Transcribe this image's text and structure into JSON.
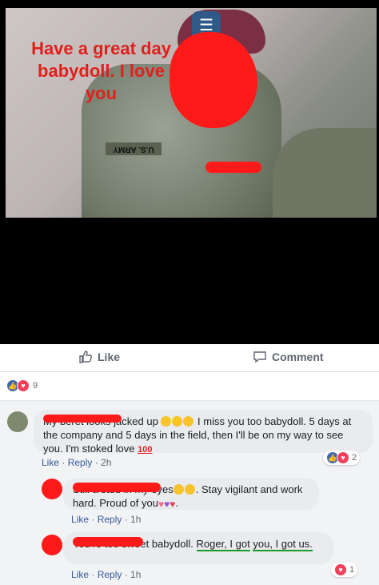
{
  "post": {
    "caption": "Have a great day babydoll. I love you",
    "nametape": "U.S. ARMY"
  },
  "actions": {
    "like_label": "Like",
    "comment_label": "Comment"
  },
  "reactions": {
    "count": "9"
  },
  "comments": [
    {
      "text_before": "My beret looks jacked up",
      "text_after": "I miss you too babydoll. 5 days at the company and 5 days in the field, then I'll be on my way to see you. I'm stoked love",
      "like": "Like",
      "reply": "Reply",
      "time": "2h",
      "reaction_count": "2"
    },
    {
      "text_before": "Still a stud in my eyes",
      "text_after": ". Stay vigilant and work hard. Proud of you",
      "text_end": ".",
      "like": "Like",
      "reply": "Reply",
      "time": "1h"
    },
    {
      "text_before": "You're too sweet babydoll.",
      "text_underlined_1": "Roger, I got",
      "text_underlined_2": "you, I got us.",
      "like": "Like",
      "reply": "Reply",
      "time": "1h",
      "reaction_count": "1"
    }
  ],
  "colors": {
    "like_blue": "#4267b2",
    "love_red": "#f33e58",
    "link_blue": "#385898",
    "redaction_red": "#ff1a1a"
  }
}
